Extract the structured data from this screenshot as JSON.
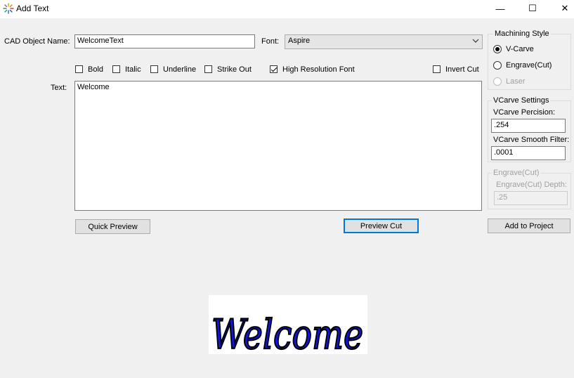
{
  "window": {
    "title": "Add Text",
    "minimize_glyph": "—",
    "maximize_glyph": "☐",
    "close_glyph": "✕"
  },
  "form": {
    "object_name_label": "CAD Object Name:",
    "object_name_value": "WelcomeText",
    "font_label": "Font:",
    "font_value": "Aspire",
    "text_label": "Text:",
    "text_value": "Welcome"
  },
  "options": {
    "bold": {
      "label": "Bold",
      "checked": false
    },
    "italic": {
      "label": "Italic",
      "checked": false
    },
    "underline": {
      "label": "Underline",
      "checked": false
    },
    "strikeout": {
      "label": "Strike Out",
      "checked": false
    },
    "high_res": {
      "label": "High Resolution Font",
      "checked": true
    },
    "invert_cut": {
      "label": "Invert Cut",
      "checked": false
    }
  },
  "machining": {
    "title": "Machining Style",
    "vcarve": "V-Carve",
    "engrave": "Engrave(Cut)",
    "laser": "Laser",
    "selected": "vcarve"
  },
  "vcarve_settings": {
    "title": "VCarve Settings",
    "precision_label": "VCarve Percision:",
    "precision_value": ".254",
    "smooth_label": "VCarve Smooth Filter:",
    "smooth_value": ".0001"
  },
  "engrave_settings": {
    "title": "Engrave(Cut)",
    "depth_label": "Engrave(Cut) Depth:",
    "depth_value": ".25"
  },
  "buttons": {
    "quick_preview": "Quick Preview",
    "preview_cut": "Preview Cut",
    "add_to_project": "Add to Project"
  },
  "preview": {
    "text": "Welcome",
    "fill_color": "#1414d2",
    "stroke_color": "#000000"
  }
}
